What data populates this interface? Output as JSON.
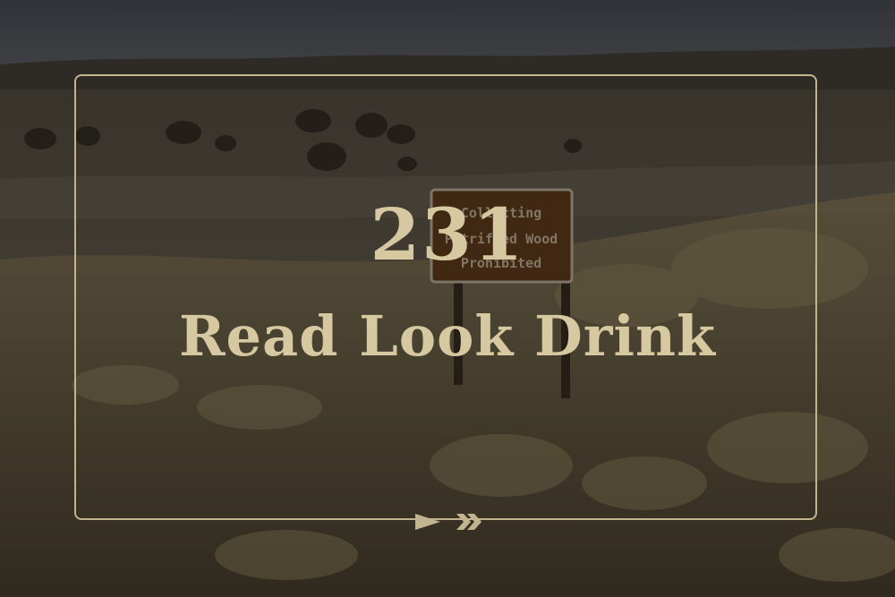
{
  "episode": {
    "number": "231",
    "title": "Read Look Drink"
  },
  "sign": {
    "lines": [
      "Collecting",
      "Petrified Wood",
      "Prohibited"
    ]
  },
  "colors": {
    "accent": "#c2b48f",
    "text": "#d6c8a0",
    "sky": "#4a4f57",
    "sign": "#6b4420"
  }
}
